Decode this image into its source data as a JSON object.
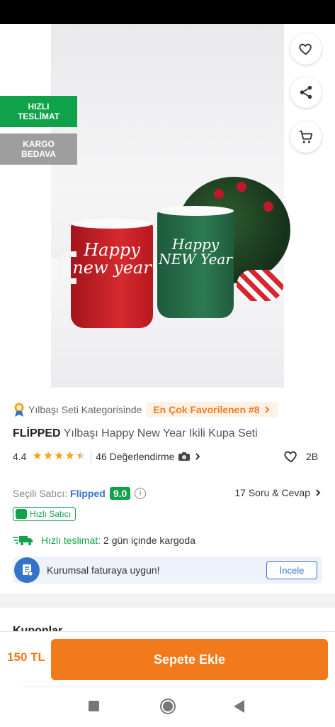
{
  "badges": {
    "fast_line1": "HIZLI",
    "fast_line2": "TESLİMAT",
    "cargo_line1": "KARGO",
    "cargo_line2": "BEDAVA"
  },
  "product_image": {
    "mug_red_text": "Happy new year",
    "mug_green_text": "Happy NEW Year"
  },
  "category": {
    "label": "Yılbaşı Seti Kategorisinde",
    "rank": "En Çok Favorilenen #8"
  },
  "product": {
    "brand": "FLİPPED",
    "name": "Yılbaşı Happy New Year Ikili Kupa Seti"
  },
  "rating": {
    "value": "4.4",
    "stars": 4.4,
    "reviews": "46 Değerlendirme",
    "favorites": "2B"
  },
  "seller": {
    "label": "Seçili Satıcı:",
    "name": "Flipped",
    "score": "9.0",
    "qa": "17 Soru & Cevap",
    "fast_seller_badge": "Hızlı Satıcı"
  },
  "delivery": {
    "label": "Hızlı teslimat:",
    "value": "2 gün içinde kargoda"
  },
  "invoice": {
    "text": "Kurumsal faturaya uygun!",
    "button": "İncele"
  },
  "coupons": {
    "title": "Kuponlar"
  },
  "cart": {
    "price": "150 TL",
    "button": "Sepete Ekle"
  },
  "colors": {
    "brand_orange": "#f27a1a",
    "success_green": "#10a24a",
    "link_blue": "#3573c9"
  }
}
